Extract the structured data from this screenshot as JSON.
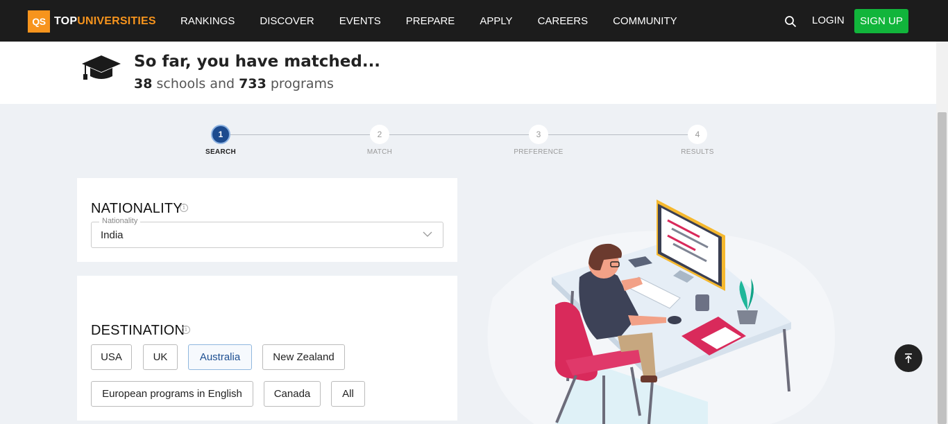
{
  "nav": {
    "logo_mark": "QS",
    "logo_top": "TOP",
    "logo_universities": "UNIVERSITIES",
    "items": [
      "RANKINGS",
      "DISCOVER",
      "EVENTS",
      "PREPARE",
      "APPLY",
      "CAREERS",
      "COMMUNITY"
    ],
    "login": "LOGIN",
    "signup": "SIGN UP"
  },
  "match": {
    "title": "So far, you have matched...",
    "schools_count": "38",
    "schools_word": "schools and",
    "programs_count": "733",
    "programs_word": "programs"
  },
  "steps": [
    {
      "num": "1",
      "label": "SEARCH",
      "active": true
    },
    {
      "num": "2",
      "label": "MATCH",
      "active": false
    },
    {
      "num": "3",
      "label": "PREFERENCE",
      "active": false
    },
    {
      "num": "4",
      "label": "RESULTS",
      "active": false
    }
  ],
  "nationality": {
    "title": "NATIONALITY",
    "field_label": "Nationality",
    "value": "India"
  },
  "destination": {
    "title": "DESTINATION",
    "options": [
      "USA",
      "UK",
      "Australia",
      "New Zealand",
      "European programs in English",
      "Canada",
      "All"
    ],
    "selected": "Australia"
  },
  "colors": {
    "nav_bg": "#1c1c1c",
    "brand_orange": "#f7941d",
    "signup_green": "#11b53b",
    "step_active": "#1c4b8f",
    "chair_red": "#d92a5b"
  },
  "icons": {
    "search": "search-icon",
    "info": "info-icon",
    "chevron": "chevron-down-icon",
    "back_to_top": "arrow-up-icon",
    "grad_cap": "graduation-cap-icon"
  }
}
